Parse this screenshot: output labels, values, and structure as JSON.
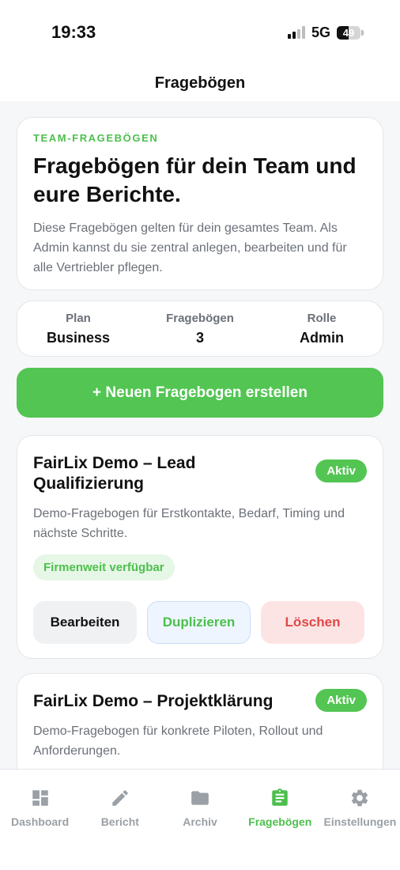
{
  "status_bar": {
    "time": "19:33",
    "network": "5G",
    "battery": "49",
    "battery_level": 0.49
  },
  "header": {
    "title": "Fragebögen"
  },
  "intro": {
    "eyebrow": "TEAM-FRAGEBÖGEN",
    "title": "Fragebögen für dein Team und eure Berichte.",
    "text": "Diese Fragebögen gelten für dein gesamtes Team. Als Admin kannst du sie zentral anlegen, bearbeiten und für alle Vertriebler pflegen."
  },
  "stats": [
    {
      "label": "Plan",
      "value": "Business"
    },
    {
      "label": "Fragebögen",
      "value": "3"
    },
    {
      "label": "Rolle",
      "value": "Admin"
    }
  ],
  "create_button": "+ Neuen Fragebogen erstellen",
  "questionnaires": [
    {
      "title": "FairLix Demo – Lead Qualifizierung",
      "status": "Aktiv",
      "description": "Demo-Fragebogen für Erstkontakte, Bedarf, Timing und nächste Schritte.",
      "tag": "Firmenweit verfügbar",
      "actions": {
        "edit": "Bearbeiten",
        "duplicate": "Duplizieren",
        "delete": "Löschen"
      }
    },
    {
      "title": "FairLix Demo – Projektklärung",
      "status": "Aktiv",
      "description": "Demo-Fragebogen für konkrete Piloten, Rollout und Anforderungen."
    }
  ],
  "tabbar": [
    {
      "label": "Dashboard",
      "icon": "dashboard-icon",
      "active": false
    },
    {
      "label": "Bericht",
      "icon": "pencil-icon",
      "active": false
    },
    {
      "label": "Archiv",
      "icon": "folder-icon",
      "active": false
    },
    {
      "label": "Fragebögen",
      "icon": "clipboard-icon",
      "active": true
    },
    {
      "label": "Einstellungen",
      "icon": "gear-icon",
      "active": false
    }
  ],
  "colors": {
    "accent": "#52c552",
    "danger": "#e04848",
    "muted": "#9aa0a6"
  }
}
